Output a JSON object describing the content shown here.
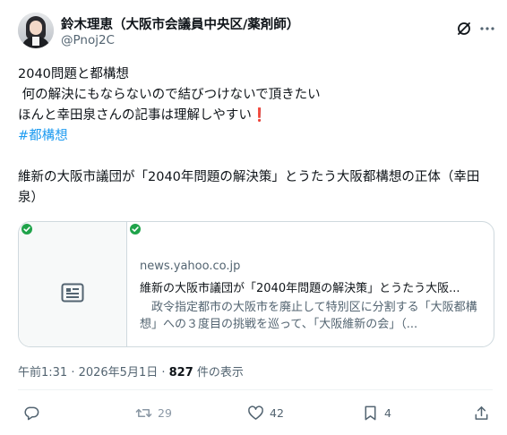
{
  "post": {
    "author_name": "鈴木理恵（大阪市会議員中央区/薬剤師）",
    "author_handle": "@Pnoj2C",
    "lines": [
      "2040問題と都構想",
      " 何の解決にもならないので結びつけないで頂きたい",
      "ほんと幸田泉さんの記事は理解しやすい",
      "#都構想",
      "維新の大阪市議団が「2040年問題の解決策」とうたう大阪都構想の正体（幸田泉）"
    ],
    "exclamation": "❗",
    "timestamp": "午前1:31 · 2026年5月1日 · ",
    "views_count": "827",
    "views_label": " 件の表示"
  },
  "card": {
    "domain": "news.yahoo.co.jp",
    "title": "維新の大阪市議団が「2040年問題の解決策」とうたう大阪...",
    "description": "　政令指定都市の大阪市を廃止して特別区に分割する「大阪都構想」への３度目の挑戦を巡って、「大阪維新の会」（..."
  },
  "actions": {
    "reply_count": "",
    "retweet_count": "29",
    "like_count": "42",
    "bookmark_count": "4"
  },
  "colors": {
    "text": "#0f1419",
    "secondary": "#536471",
    "accent": "#1d9bf0",
    "border": "#cfd9de",
    "check_green": "#1fa34a",
    "exclamation_red": "#d6202b"
  },
  "icons": [
    "grok-icon",
    "more-icon",
    "news-icon",
    "check-icon",
    "reply-icon",
    "retweet-icon",
    "like-icon",
    "bookmark-icon",
    "share-icon"
  ]
}
